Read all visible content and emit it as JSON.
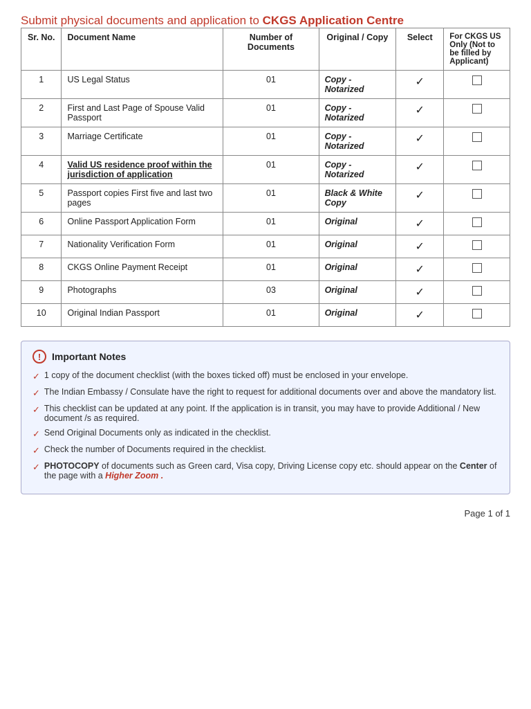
{
  "title": {
    "prefix": "Submit physical documents and application to ",
    "highlight": "CKGS Application Centre"
  },
  "table": {
    "headers": {
      "srno": "Sr. No.",
      "docname": "Document Name",
      "numdocs": "Number of Documents",
      "origcopy": "Original / Copy",
      "select": "Select",
      "ckgs": "For CKGS US Only (Not to be filled by Applicant)"
    },
    "rows": [
      {
        "srno": "1",
        "docname": "US Legal Status",
        "numdocs": "01",
        "origcopy": "Copy - Notarized",
        "selected": true
      },
      {
        "srno": "2",
        "docname": "First and Last Page of Spouse Valid Passport",
        "numdocs": "01",
        "origcopy": "Copy - Notarized",
        "selected": true
      },
      {
        "srno": "3",
        "docname": "Marriage Certificate",
        "numdocs": "01",
        "origcopy": "Copy - Notarized",
        "selected": true
      },
      {
        "srno": "4",
        "docname": "Valid US residence proof within the jurisdiction of application",
        "numdocs": "01",
        "origcopy": "Copy - Notarized",
        "selected": true,
        "underline": true
      },
      {
        "srno": "5",
        "docname": "Passport copies First five and last two pages",
        "numdocs": "01",
        "origcopy": "Black & White Copy",
        "selected": true
      },
      {
        "srno": "6",
        "docname": "Online Passport Application Form",
        "numdocs": "01",
        "origcopy": "Original",
        "selected": true
      },
      {
        "srno": "7",
        "docname": "Nationality Verification Form",
        "numdocs": "01",
        "origcopy": "Original",
        "selected": true
      },
      {
        "srno": "8",
        "docname": "CKGS Online Payment Receipt",
        "numdocs": "01",
        "origcopy": "Original",
        "selected": true
      },
      {
        "srno": "9",
        "docname": "Photographs",
        "numdocs": "03",
        "origcopy": "Original",
        "selected": true
      },
      {
        "srno": "10",
        "docname": "Original Indian Passport",
        "numdocs": "01",
        "origcopy": "Original",
        "selected": true
      }
    ]
  },
  "important_notes": {
    "title": "Important Notes",
    "notes": [
      "1 copy of the document checklist (with the boxes ticked off) must be enclosed in your envelope.",
      "The Indian Embassy / Consulate have the right to request for additional documents over and above the mandatory list.",
      "This checklist can be updated at any point. If the application is in transit, you may have to provide Additional / New document /s as required.",
      "Send Original Documents only as indicated in the checklist.",
      "Check the number of Documents required in the checklist.",
      "PHOTOCOPY_of_documents_such_as_Green_card,_Visa_copy,_Driving_License_copy_etc._should_appear_on_the_Center_of_the_page_with_a_Higher_Zoom_."
    ]
  },
  "footer": {
    "text": "Page 1 of 1"
  }
}
